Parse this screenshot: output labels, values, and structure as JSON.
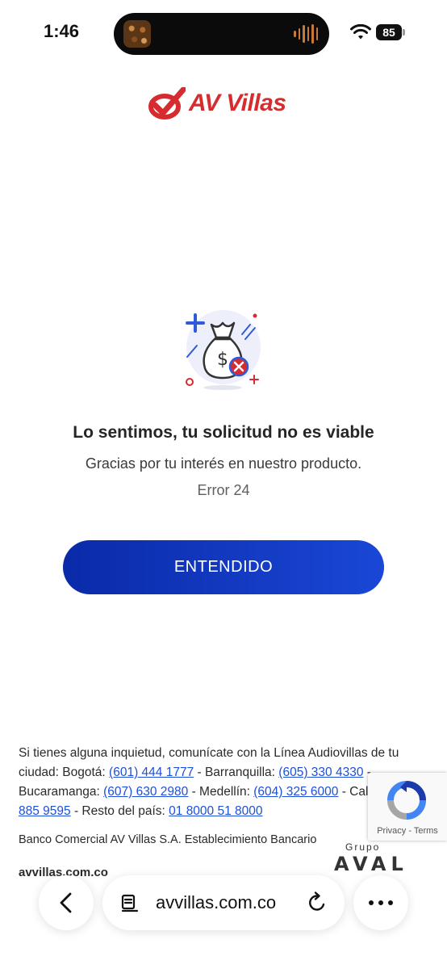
{
  "status_bar": {
    "time": "1:46",
    "battery": "85"
  },
  "brand": {
    "logo_text": "AV Villas",
    "accent_color": "#d62b2f"
  },
  "icons": {
    "illustration": "money-bag-rejected-icon",
    "back": "chevron-left-icon",
    "page": "page-menu-icon",
    "reload": "reload-icon",
    "more": "more-dots-icon"
  },
  "message": {
    "title": "Lo sentimos, tu solicitud no es viable",
    "subtitle": "Gracias por tu interés en nuestro producto.",
    "error_code": "Error 24"
  },
  "primary_button": {
    "label": "ENTENDIDO",
    "color": "#1230b8"
  },
  "help": {
    "intro": "Si tienes alguna inquietud, comunícate con la Línea Audiovillas de tu ciudad: ",
    "bogota_label": "Bogotá: ",
    "bogota_phone": "(601) 444 1777",
    "sep1": " - Barranquilla: ",
    "barranquilla_phone": "(605) 330 4330",
    "sep2": " - Bucaramanga: ",
    "bucaramanga_phone": "(607) 630 2980",
    "sep3": " - Medellín: ",
    "medellin_phone": "(604) 325 6000",
    "sep4": " - Cali: ",
    "cali_phone": "(602) 885 9595",
    "sep5": " - Resto del país: ",
    "national_phone": "01 8000 51 8000"
  },
  "legal": {
    "text": "Banco Comercial AV Villas S.A. Establecimiento Bancario",
    "domain": "avvillas.com.co"
  },
  "group_logo": {
    "label": "Grupo",
    "name": "AVAL"
  },
  "recaptcha": {
    "privacy": "Privacy",
    "separator": " - ",
    "terms": "Terms"
  },
  "browser": {
    "url": "avvillas.com.co"
  }
}
